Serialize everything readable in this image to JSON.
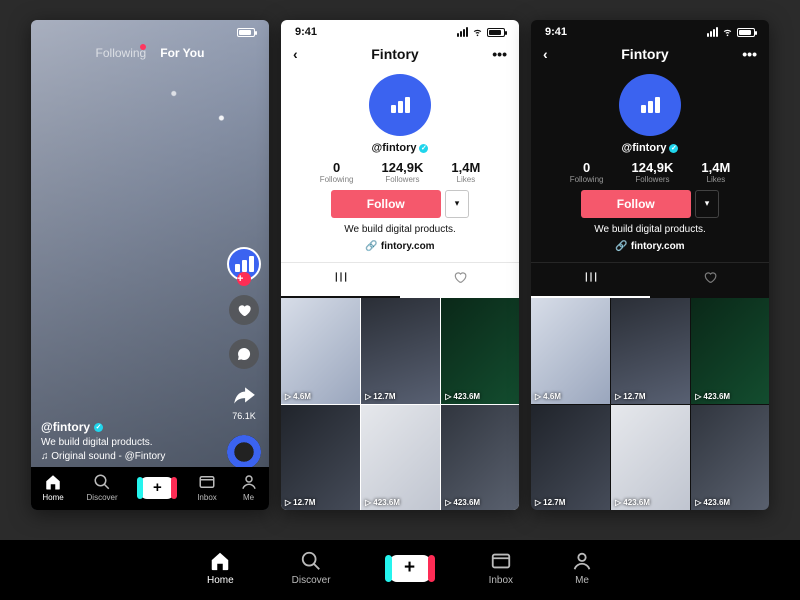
{
  "status": {
    "time": "9:41"
  },
  "feed": {
    "tab_following": "Following",
    "tab_foryou": "For You",
    "share_count": "76.1K",
    "handle": "@fintory",
    "bio": "We build digital products.",
    "sound": "Original sound - @Fintory"
  },
  "profile": {
    "name": "Fintory",
    "handle": "@fintory",
    "following_n": "0",
    "following_l": "Following",
    "followers_n": "124,9K",
    "followers_l": "Followers",
    "likes_n": "1,4M",
    "likes_l": "Likes",
    "follow_btn": "Follow",
    "bio": "We build digital products.",
    "link": "fintory.com",
    "videos": [
      {
        "views": "4.6M"
      },
      {
        "views": "12.7M"
      },
      {
        "views": "423.6M"
      },
      {
        "views": "12.7M"
      },
      {
        "views": "423.6M"
      },
      {
        "views": "423.6M"
      }
    ]
  },
  "nav": {
    "home": "Home",
    "discover": "Discover",
    "inbox": "Inbox",
    "me": "Me"
  }
}
